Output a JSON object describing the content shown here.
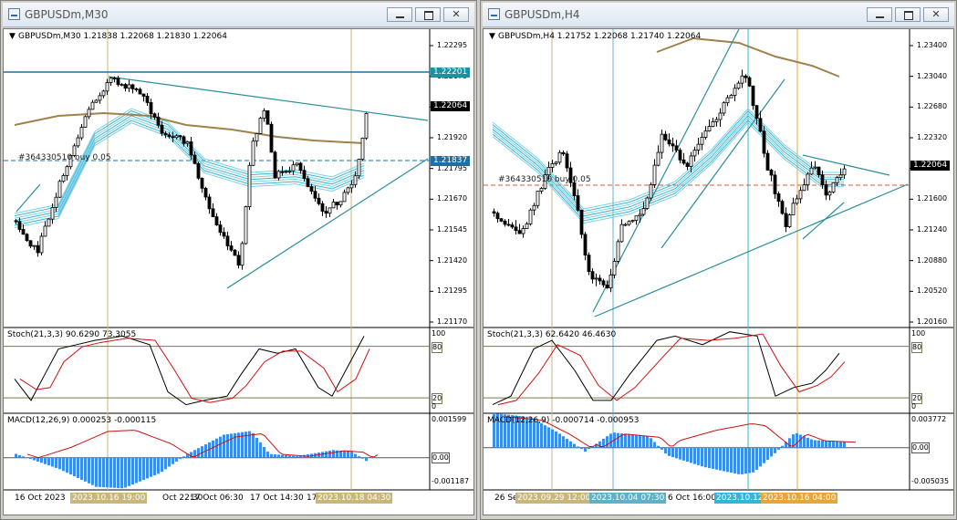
{
  "windows": [
    {
      "title": "GBPUSDm,M30",
      "header": "GBPUSDm,M30  1.21838 1.22068 1.21830 1.22064",
      "order_label": "#364330510 buy 0.05",
      "price_labels": [
        "1.22295",
        "1.22170",
        "1.22045",
        "1.21920",
        "1.21795",
        "1.21670",
        "1.21545",
        "1.21420",
        "1.21295",
        "1.21170"
      ],
      "price_tags": [
        {
          "value": "1.22201",
          "color": "#1f8fa5"
        },
        {
          "value": "1.22064",
          "color": "#000000"
        },
        {
          "value": "1.21837",
          "color": "#1f6fa5"
        }
      ],
      "stoch": {
        "header": "Stoch(21,3,3) 90.6290 73.3055",
        "levels": [
          "100",
          "80",
          "20",
          "0"
        ]
      },
      "macd": {
        "header": "MACD(12,26,9) 0.000253 -0.000115",
        "levels": [
          "0.001599",
          "0.00",
          "-0.001187"
        ]
      },
      "time_labels": [
        {
          "text": "16 Oct 2023",
          "highlight": ""
        },
        {
          "text": "2023.10.16 19:00",
          "highlight": "#c9b77a"
        },
        {
          "text": "Oct 22:30",
          "highlight": ""
        },
        {
          "text": "17 Oct 06:30",
          "highlight": ""
        },
        {
          "text": "17 Oct 14:30",
          "highlight": ""
        },
        {
          "text": "17",
          "highlight": ""
        },
        {
          "text": "2023.10.18 04:30",
          "highlight": "#c9b77a"
        }
      ]
    },
    {
      "title": "GBPUSDm,H4",
      "header": "GBPUSDm,H4  1.21752 1.22068 1.21740 1.22064",
      "order_label": "#364330510 buy 0.05",
      "price_labels": [
        "1.23400",
        "1.23040",
        "1.22680",
        "1.22320",
        "1.21960",
        "1.21600",
        "1.21240",
        "1.20880",
        "1.20520",
        "1.20160"
      ],
      "price_tags": [
        {
          "value": "1.22064",
          "color": "#000000"
        }
      ],
      "stoch": {
        "header": "Stoch(21,3,3) 62.6420 46.4630",
        "levels": [
          "100",
          "80",
          "20",
          "0"
        ]
      },
      "macd": {
        "header": "MACD(12,26,9) -0.000714 -0.000953",
        "levels": [
          "0.003772",
          "0.00",
          "-0.005035"
        ]
      },
      "time_labels": [
        {
          "text": "26 Se",
          "highlight": ""
        },
        {
          "text": "2023.09.29 12:00",
          "highlight": "#c9b77a"
        },
        {
          "text": "2023.10.04 07:30",
          "highlight": "#5fb0c8"
        },
        {
          "text": "6 Oct 16:00",
          "highlight": ""
        },
        {
          "text": "2023.10.12",
          "highlight": "#33b5d8"
        },
        {
          "text": "2023.10.16 04:00",
          "highlight": "#e7a63a"
        }
      ]
    }
  ]
}
